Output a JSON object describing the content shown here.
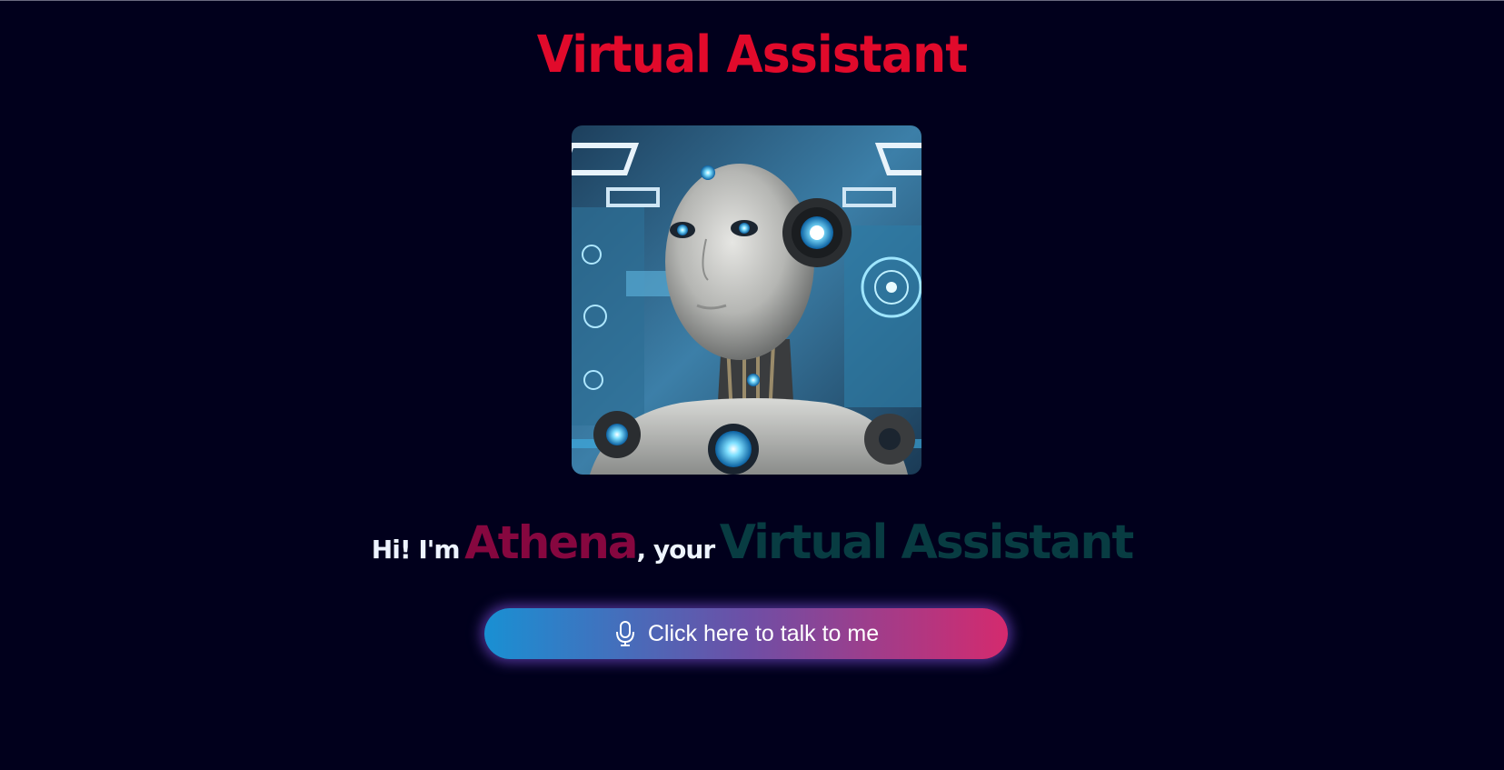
{
  "page": {
    "title": "Virtual Assistant"
  },
  "portrait": {
    "subject": "humanoid robot portrait"
  },
  "greeting": {
    "prefix": "Hi! I'm",
    "name": "Athena",
    "middle": ", your",
    "role": "Virtual Assistant"
  },
  "talk_button": {
    "label": "Click here to talk to me",
    "icon": "microphone-icon"
  },
  "colors": {
    "background": "#01001c",
    "title": "#e10a2b",
    "name": "#86073f",
    "role": "#083c42",
    "button_gradient_start": "#1990d3",
    "button_gradient_end": "#d42a6e"
  }
}
